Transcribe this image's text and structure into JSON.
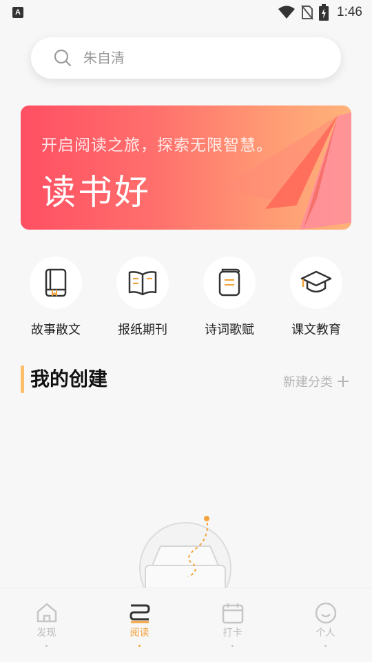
{
  "status_bar": {
    "app_badge": "A",
    "time": "1:46"
  },
  "search": {
    "placeholder": "朱自清"
  },
  "banner": {
    "subtitle": "开启阅读之旅，探索无限智慧。",
    "title": "读书好"
  },
  "categories": [
    {
      "label": "故事散文",
      "icon": "book-icon"
    },
    {
      "label": "报纸期刊",
      "icon": "open-book-icon"
    },
    {
      "label": "诗词歌赋",
      "icon": "notebook-icon"
    },
    {
      "label": "课文教育",
      "icon": "graduation-cap-icon"
    }
  ],
  "section": {
    "title": "我的创建",
    "new_category": "新建分类"
  },
  "bottom_nav": {
    "items": [
      {
        "label": "发现",
        "icon": "home-icon"
      },
      {
        "label": "阅读",
        "icon": "reading-icon",
        "active": true
      },
      {
        "label": "打卡",
        "icon": "calendar-icon"
      },
      {
        "label": "个人",
        "icon": "smiley-icon"
      }
    ]
  },
  "colors": {
    "accent": "#f3a33c",
    "banner_start": "#ff4f63",
    "banner_end": "#ffb37a",
    "section_bar": "#ffbe6a"
  }
}
